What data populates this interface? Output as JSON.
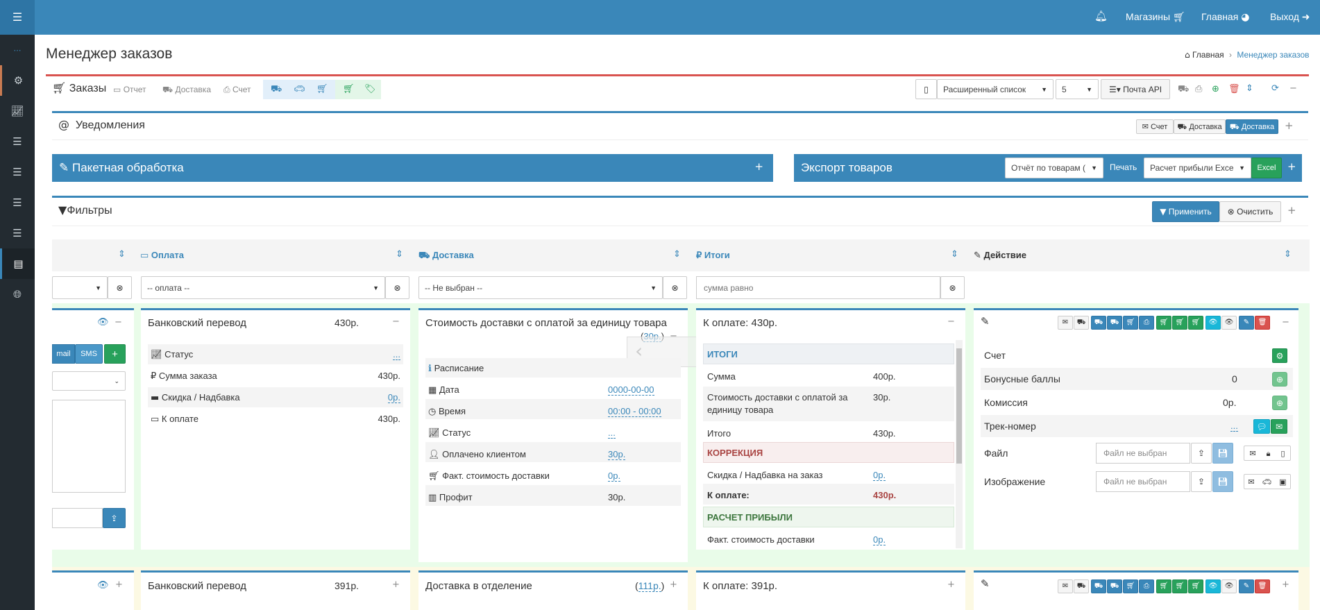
{
  "topbar": {
    "bell_icon": "bell-icon",
    "stores": "Магазины",
    "home": "Главная",
    "exit": "Выход"
  },
  "page": {
    "title": "Менеджер заказов",
    "crumb_home": "Главная",
    "crumb_current": "Менеджер заказов"
  },
  "toolbar": {
    "orders": "Заказы",
    "report": "Отчет",
    "delivery": "Доставка",
    "invoice": "Счет",
    "list_view": "Расширенный список",
    "per_page": "5",
    "mail_api": "Почта API"
  },
  "notifications": {
    "title": "Уведомления",
    "btn_invoice": "Счет",
    "btn_delivery1": "Доставка",
    "btn_delivery2": "Доставка"
  },
  "batch": {
    "title": "Пакетная обработка"
  },
  "export": {
    "title": "Экспорт товаров",
    "report_select": "Отчёт по товарам (",
    "print": "Печать",
    "profit_select": "Расчет прибыли Exce",
    "excel": "Excel"
  },
  "filters": {
    "title": "Фильтры",
    "apply": "Применить",
    "clear": "Очистить"
  },
  "columns": {
    "payment": "Оплата",
    "delivery": "Доставка",
    "totals": "Итоги",
    "action": "Действие"
  },
  "filter_inputs": {
    "payment": "-- оплата --",
    "delivery": "-- Не выбран --",
    "sum_placeholder": "сумма равно"
  },
  "order1": {
    "comm": {
      "email": "mail",
      "sms": "SMS"
    },
    "payment": {
      "method": "Банковский перевод",
      "amount": "430р.",
      "rows": [
        {
          "icon": "chart-icon",
          "label": "Статус",
          "value": "..."
        },
        {
          "icon": "ruble-icon",
          "label": "Сумма заказа",
          "value": "430р."
        },
        {
          "icon": "minus-icon",
          "label": "Скидка / Надбавка",
          "value": "0р."
        },
        {
          "icon": "card-icon",
          "label": "К оплате",
          "value": "430р."
        }
      ]
    },
    "delivery": {
      "title": "Стоимость доставки с оплатой за единицу товара",
      "price": "30р.",
      "schedule": "Расписание",
      "rows": [
        {
          "icon": "calendar-icon",
          "label": "Дата",
          "value": "0000-00-00"
        },
        {
          "icon": "clock-icon",
          "label": "Время",
          "value": "00:00 - 00:00"
        },
        {
          "icon": "chart-icon",
          "label": "Статус",
          "value": "..."
        },
        {
          "icon": "user-plus-icon",
          "label": "Оплачено клиентом",
          "value": "30р."
        },
        {
          "icon": "cart-icon",
          "label": "Факт. стоимость доставки",
          "value": "0р."
        },
        {
          "icon": "bar-chart-icon",
          "label": "Профит",
          "value": "30р."
        }
      ]
    },
    "totals": {
      "title": "К оплате: 430р.",
      "sec1": "ИТОГИ",
      "sum_l": "Сумма",
      "sum_v": "400р.",
      "dl_l1": "Стоимость доставки с оплатой за",
      "dl_l2": "единицу товара",
      "dl_v": "30р.",
      "tot_l": "Итого",
      "tot_v": "430р.",
      "sec2": "КОРРЕКЦИЯ",
      "disc_l": "Скидка / Надбавка на заказ",
      "disc_v": "0р.",
      "pay_l": "К оплате:",
      "pay_v": "430р.",
      "sec3": "РАСЧЕТ ПРИБЫЛИ",
      "fact_l": "Факт. стоимость доставки",
      "fact_v": "0р."
    },
    "action": {
      "invoice": "Счет",
      "bonus": "Бонусные баллы",
      "bonus_v": "0",
      "commission": "Комиссия",
      "commission_v": "0р.",
      "track": "Трек-номер",
      "track_v": "...",
      "file": "Файл",
      "file_ph": "Файл не выбран",
      "image": "Изображение",
      "image_ph": "Файл не выбран"
    }
  },
  "order2": {
    "payment_method": "Банковский перевод",
    "amount": "391р.",
    "delivery_title": "Доставка в отделение",
    "delivery_price": "111р.",
    "totals_title": "К оплате: 391р."
  },
  "colors": {
    "brand": "#3a87b9",
    "sidebar": "#232b31",
    "success": "#28a15b",
    "danger": "#d9534f",
    "info": "#19b7d8",
    "row_bg": "#e9fce9"
  }
}
